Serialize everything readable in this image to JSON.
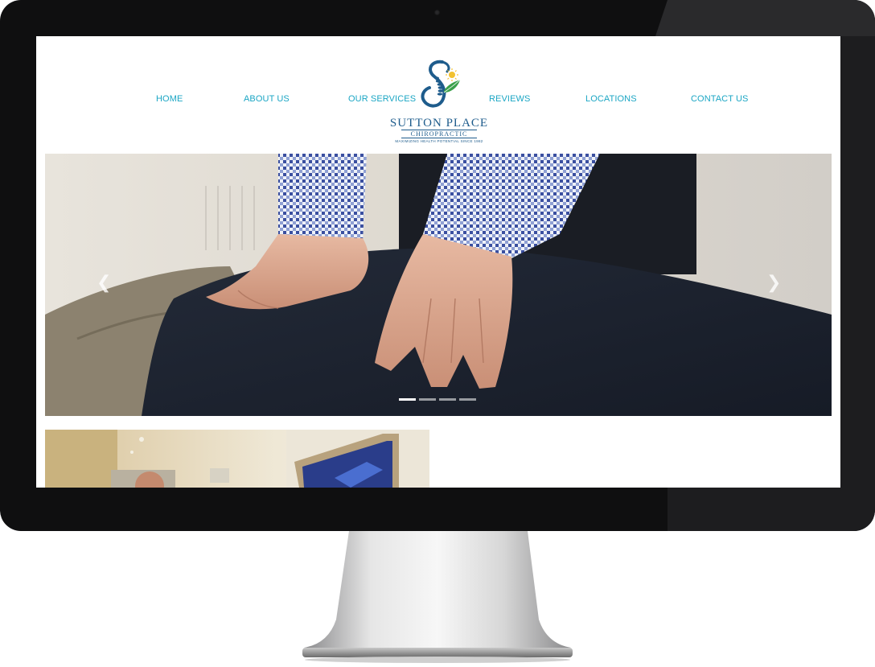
{
  "nav": {
    "items": [
      {
        "label": "HOME"
      },
      {
        "label": "ABOUT US"
      },
      {
        "label": "OUR SERVICES"
      },
      {
        "label": "REVIEWS"
      },
      {
        "label": "LOCATIONS"
      },
      {
        "label": "CONTACT US"
      }
    ]
  },
  "logo": {
    "name": "SUTTON PLACE",
    "sub": "CHIROPRACTIC",
    "tagline": "MAXIMIZING HEALTH POTENTIAL SINCE 1982"
  },
  "carousel": {
    "prev_icon": "chevron-left-icon",
    "next_icon": "chevron-right-icon",
    "slide_count": 4,
    "active_index": 0
  },
  "colors": {
    "nav_link": "#1ba6c4",
    "logo_navy": "#1e5c8c",
    "accent_green": "#3aa04a",
    "accent_sun": "#f2c12e",
    "bezel": "#0f0f10"
  }
}
